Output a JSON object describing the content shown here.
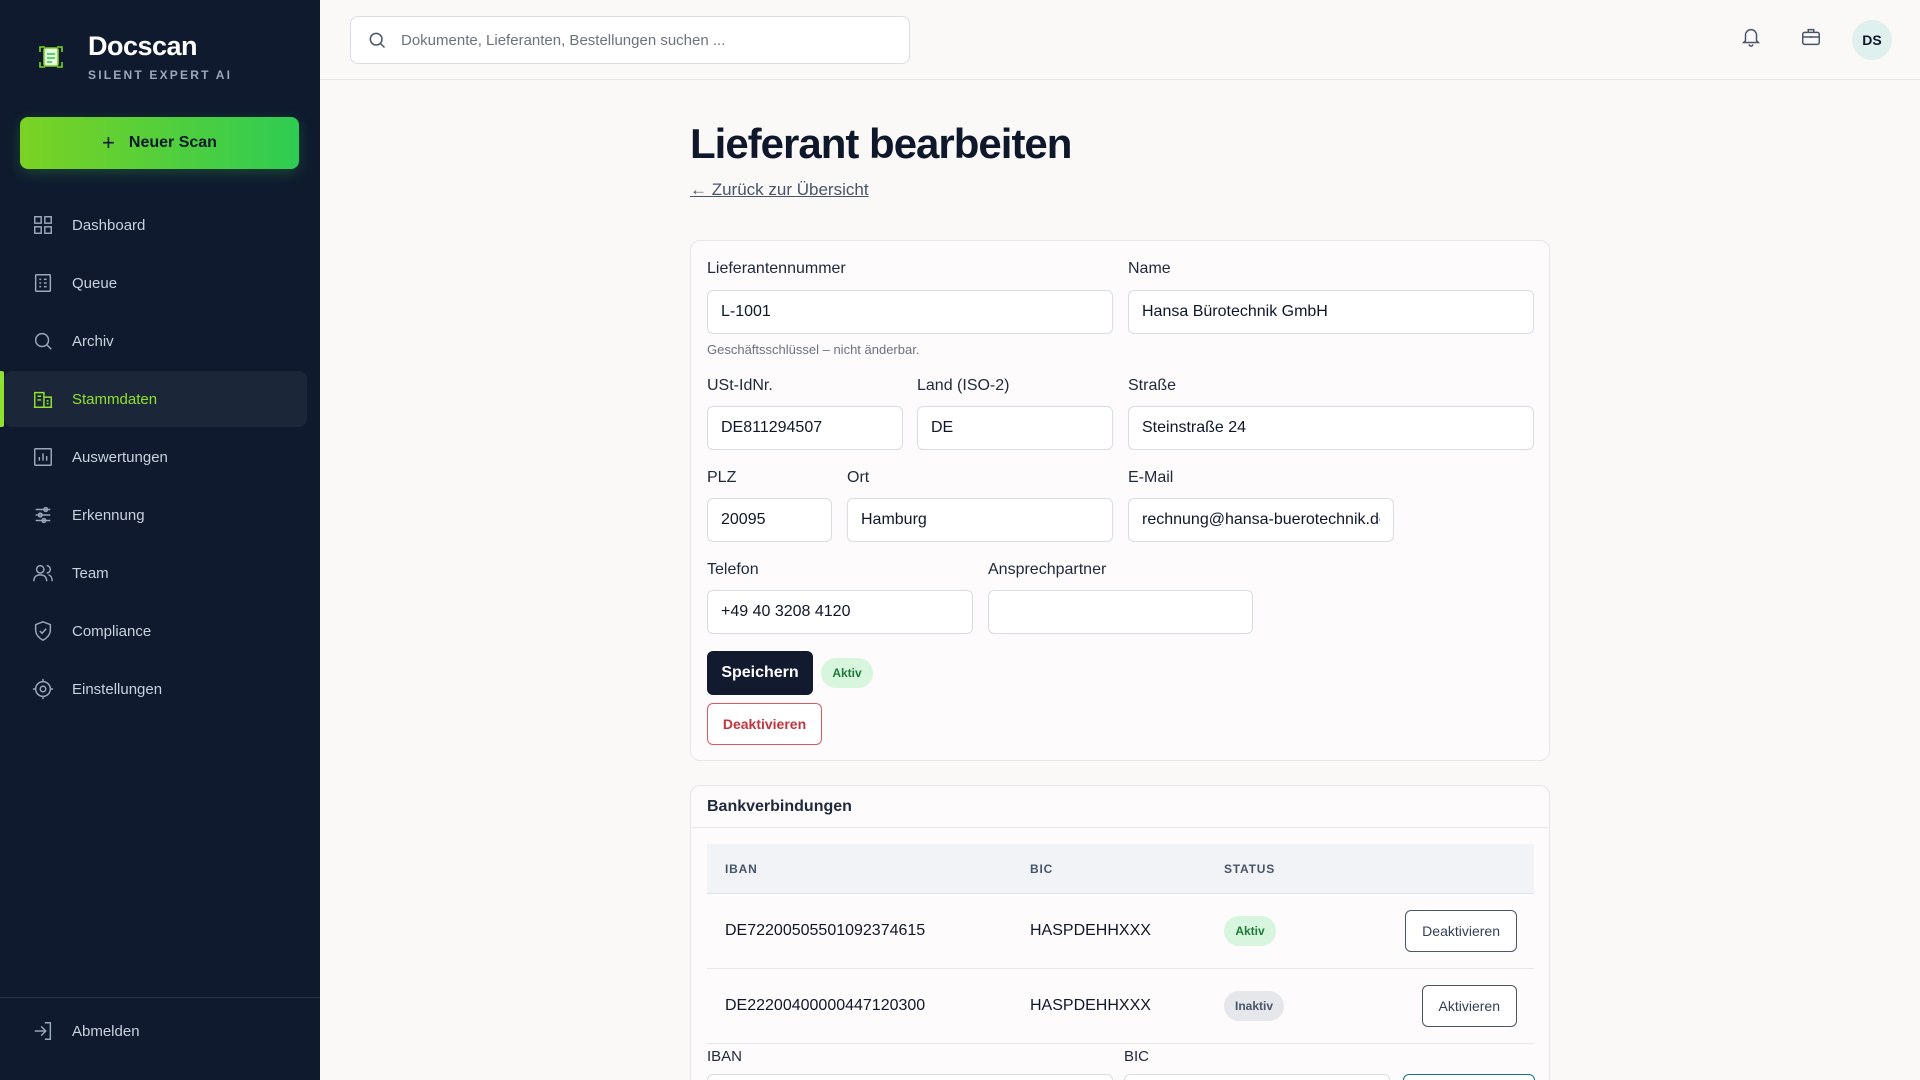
{
  "app": {
    "name": "Docscan",
    "tagline": "SILENT EXPERT AI",
    "new_scan_label": "Neuer Scan"
  },
  "sidebar": {
    "items": [
      {
        "label": "Dashboard",
        "icon": "dashboard-icon"
      },
      {
        "label": "Queue",
        "icon": "queue-icon"
      },
      {
        "label": "Archiv",
        "icon": "search-icon"
      },
      {
        "label": "Stammdaten",
        "icon": "building-icon",
        "active": true
      },
      {
        "label": "Auswertungen",
        "icon": "chart-icon"
      },
      {
        "label": "Erkennung",
        "icon": "sliders-icon"
      },
      {
        "label": "Team",
        "icon": "users-icon"
      },
      {
        "label": "Compliance",
        "icon": "shield-icon"
      },
      {
        "label": "Einstellungen",
        "icon": "gear-icon"
      }
    ],
    "logout_label": "Abmelden",
    "accent": "#8ee12f"
  },
  "topbar": {
    "search_placeholder": "Dokumente, Lieferanten, Bestellungen suchen ...",
    "avatar_initials": "DS"
  },
  "page": {
    "title": "Lieferant bearbeiten",
    "back_link": "← Zurück zur Übersicht"
  },
  "form": {
    "supplier_number": {
      "label": "Lieferantennummer",
      "value": "L-1001",
      "hint": "Geschäftsschlüssel – nicht änderbar."
    },
    "name": {
      "label": "Name",
      "value": "Hansa Bürotechnik GmbH"
    },
    "vat_id": {
      "label": "USt-IdNr.",
      "value": "DE811294507"
    },
    "country": {
      "label": "Land (ISO-2)",
      "value": "DE"
    },
    "street": {
      "label": "Straße",
      "value": "Steinstraße 24"
    },
    "zip": {
      "label": "PLZ",
      "value": "20095"
    },
    "city": {
      "label": "Ort",
      "value": "Hamburg"
    },
    "email": {
      "label": "E-Mail",
      "value": "rechnung@hansa-buerotechnik.de"
    },
    "phone": {
      "label": "Telefon",
      "value": "+49 40 3208 4120"
    },
    "contact": {
      "label": "Ansprechpartner",
      "value": ""
    },
    "save_label": "Speichern",
    "status_badge": "Aktiv",
    "deactivate_label": "Deaktivieren"
  },
  "bank": {
    "title": "Bankverbindungen",
    "columns": [
      "IBAN",
      "BIC",
      "STATUS"
    ],
    "rows": [
      {
        "iban": "DE72200505501092374615",
        "bic": "HASPDEHHXXX",
        "status": "Aktiv",
        "action": "Deaktivieren"
      },
      {
        "iban": "DE22200400000447120300",
        "bic": "HASPDEHHXXX",
        "status": "Inaktiv",
        "action": "Aktivieren"
      }
    ],
    "new_iban_label": "IBAN",
    "new_bic_label": "BIC"
  }
}
